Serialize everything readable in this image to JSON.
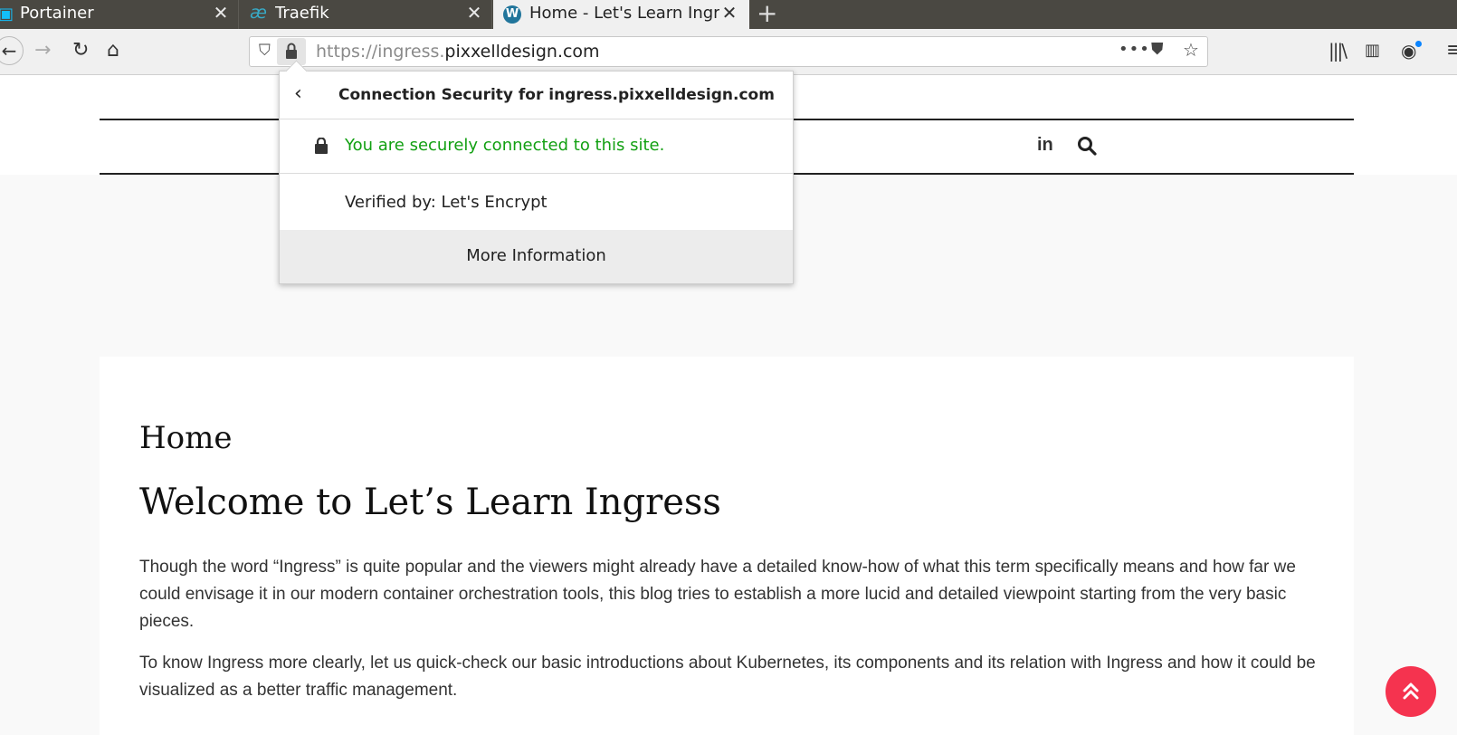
{
  "browser": {
    "tabs": [
      {
        "label": "Portainer"
      },
      {
        "label": "Traefik"
      },
      {
        "label": "Home - Let's Learn Ingress"
      }
    ],
    "url_prefix": "https://ingress.",
    "url_domain": "pixxelldesign.com"
  },
  "security_popup": {
    "title": "Connection Security for ingress.pixxelldesign.com",
    "status": "You are securely connected to this site.",
    "verified": "Verified by: Let's Encrypt",
    "more_button": "More Information"
  },
  "page": {
    "social_linkedin": "in",
    "heading": "Home",
    "title": "Welcome to Let’s Learn Ingress",
    "paragraphs": [
      "Though the word “Ingress” is quite popular and the viewers might already have a detailed know-how of what this term specifically means and how far we could envisage it in our modern container orchestration tools, this blog tries to establish a more lucid and detailed viewpoint starting from the very basic pieces.",
      "To know Ingress more clearly, let us quick-check our basic introductions about Kubernetes, its components and its relation with Ingress and how it could be visualized as a better traffic management."
    ]
  },
  "colors": {
    "secure_green": "#12a012",
    "accent_red": "#f5334f",
    "tab_bar": "#4a4842"
  }
}
